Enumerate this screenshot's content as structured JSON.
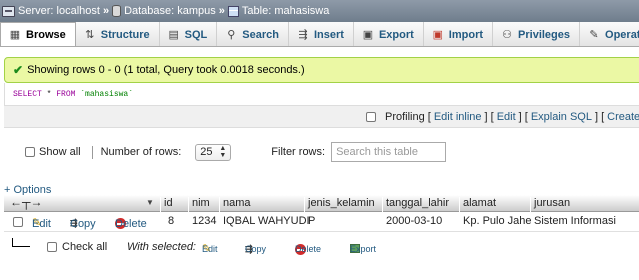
{
  "breadcrumb": {
    "server": "Server: localhost",
    "database": "Database: kampus",
    "table": "Table: mahasiswa",
    "separator": "»"
  },
  "tabs": [
    {
      "label": "Browse",
      "icon": "browse-icon"
    },
    {
      "label": "Structure",
      "icon": "structure-icon"
    },
    {
      "label": "SQL",
      "icon": "sql-icon"
    },
    {
      "label": "Search",
      "icon": "search-icon"
    },
    {
      "label": "Insert",
      "icon": "insert-icon"
    },
    {
      "label": "Export",
      "icon": "export-icon"
    },
    {
      "label": "Import",
      "icon": "import-icon"
    },
    {
      "label": "Privileges",
      "icon": "privileges-icon"
    },
    {
      "label": "Operations",
      "icon": "operations-icon"
    }
  ],
  "message": {
    "text": "Showing rows 0 - 0 (1 total, Query took 0.0018 seconds.)"
  },
  "sql": {
    "select": "SELECT",
    "star": " * ",
    "from": "FROM",
    "table": " `mahasiswa`"
  },
  "sql_actions": {
    "profiling": "Profiling",
    "edit_inline": "Edit inline",
    "edit": "Edit",
    "explain": "Explain SQL",
    "create_php": "Create PHP"
  },
  "nav": {
    "show_all": "Show all",
    "rows_label": "Number of rows:",
    "rows_value": "25",
    "filter_label": "Filter rows:",
    "filter_placeholder": "Search this table"
  },
  "options_label": "+ Options",
  "table": {
    "columns": [
      "id",
      "nim",
      "nama",
      "jenis_kelamin",
      "tanggal_lahir",
      "alamat",
      "jurusan"
    ],
    "rows": [
      {
        "id": "8",
        "nim": "1234",
        "nama": "IQBAL WAHYUDI",
        "jenis_kelamin": "P",
        "tanggal_lahir": "2000-03-10",
        "alamat": "Kp. Pulo Jahe",
        "jurusan": "Sistem Informasi"
      }
    ],
    "row_actions": {
      "edit": "Edit",
      "copy": "Copy",
      "delete": "Delete"
    }
  },
  "footer": {
    "check_all": "Check all",
    "with_selected": "With selected:",
    "edit": "Edit",
    "copy": "Copy",
    "delete": "Delete",
    "export": "Export"
  }
}
